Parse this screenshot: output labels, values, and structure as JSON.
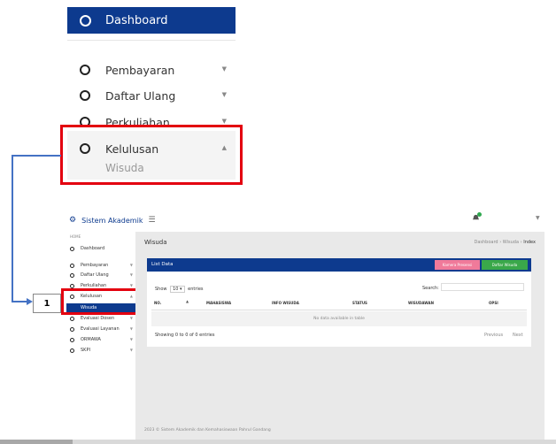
{
  "zoom_menu": {
    "dashboard": "Dashboard",
    "items": [
      {
        "label": "Pembayaran"
      },
      {
        "label": "Daftar Ulang"
      },
      {
        "label": "Perkuliahan"
      },
      {
        "label": "Kelulusan"
      }
    ],
    "submenu": "Wisuda"
  },
  "annotation": {
    "number": "1"
  },
  "app": {
    "title": "Sistem Akademik",
    "sidebar": {
      "home_label": "HOME",
      "items": [
        {
          "label": "Dashboard"
        },
        {
          "label": "Pembayaran"
        },
        {
          "label": "Daftar Ulang"
        },
        {
          "label": "Perkuliahan"
        },
        {
          "label": "Kelulusan"
        },
        {
          "label": "Wisuda"
        },
        {
          "label": "Evaluasi Dosen"
        },
        {
          "label": "Evaluasi Layanan"
        },
        {
          "label": "ORMAWA"
        },
        {
          "label": "SKPI"
        }
      ]
    },
    "page_title": "Wisuda",
    "breadcrumb": {
      "dashboard": "Dashboard",
      "sep": "›",
      "wisuda": "Wisuda",
      "index": "Index"
    },
    "card": {
      "title": "List Data",
      "btn_pink": "Kamera Presensi",
      "btn_green": "Daftar Wisuda",
      "show_prefix": "Show",
      "show_value": "10",
      "show_suffix": "entries",
      "search_label": "Search:",
      "columns": [
        "NO.",
        "MAHASISWA",
        "INFO WISUDA",
        "STATUS",
        "WISUDAWAN",
        "OPSI"
      ],
      "empty": "No data available in table",
      "info": "Showing 0 to 0 of 0 entries",
      "prev": "Previous",
      "next": "Next"
    },
    "footer": "2023 © Sistem Akademik dan Kemahasiswaan Pahrul Gandang"
  }
}
